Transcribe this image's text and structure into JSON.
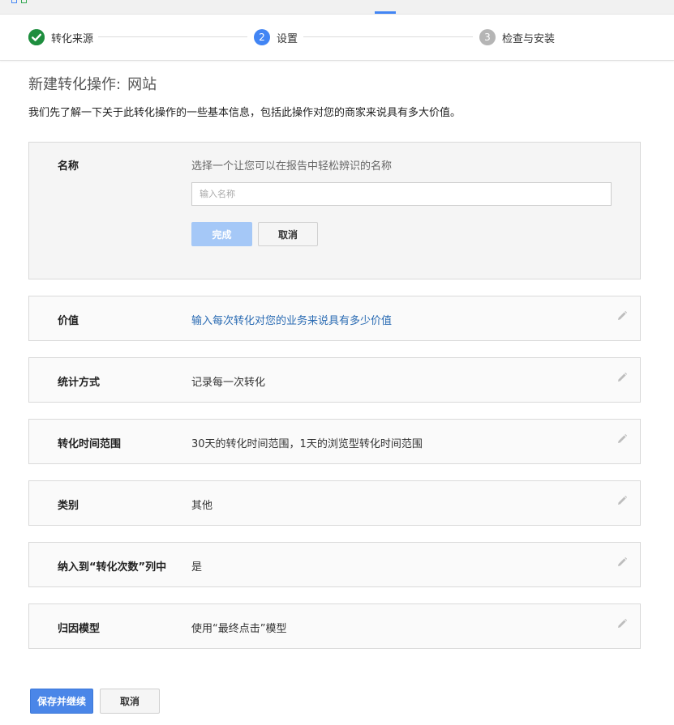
{
  "stepper": {
    "steps": [
      {
        "number": "",
        "label": "转化来源",
        "state": "complete"
      },
      {
        "number": "2",
        "label": "设置",
        "state": "active"
      },
      {
        "number": "3",
        "label": "检查与安装",
        "state": "pending"
      }
    ]
  },
  "page": {
    "title_prefix": "新建转化操作:",
    "title_type": "网站",
    "description": "我们先了解一下关于此转化操作的一些基本信息，包括此操作对您的商家来说具有多大价值。"
  },
  "name_section": {
    "label": "名称",
    "hint": "选择一个让您可以在报告中轻松辨识的名称",
    "input_placeholder": "输入名称",
    "input_value": "",
    "done_label": "完成",
    "cancel_label": "取消"
  },
  "settings": [
    {
      "label": "价值",
      "value": "输入每次转化对您的业务来说具有多少价值",
      "is_link": true
    },
    {
      "label": "统计方式",
      "value": "记录每一次转化"
    },
    {
      "label": "转化时间范围",
      "value": "30天的转化时间范围，1天的浏览型转化时间范围"
    },
    {
      "label": "类别",
      "value": "其他"
    },
    {
      "label": "纳入到“转化次数”列中",
      "value": "是"
    },
    {
      "label": "归因模型",
      "value": "使用“最终点击”模型"
    }
  ],
  "footer": {
    "save_label": "保存并继续",
    "cancel_label": "取消"
  },
  "icons": {
    "step_complete": "checkmark-icon",
    "edit": "pencil-icon"
  },
  "colors": {
    "accent": "#4285f4",
    "complete": "#1e8e3e",
    "pending": "#b5b5b5",
    "link": "#2a6bb3",
    "primary_button": "#4a86e8",
    "disabled_button": "#a5c8f7"
  }
}
